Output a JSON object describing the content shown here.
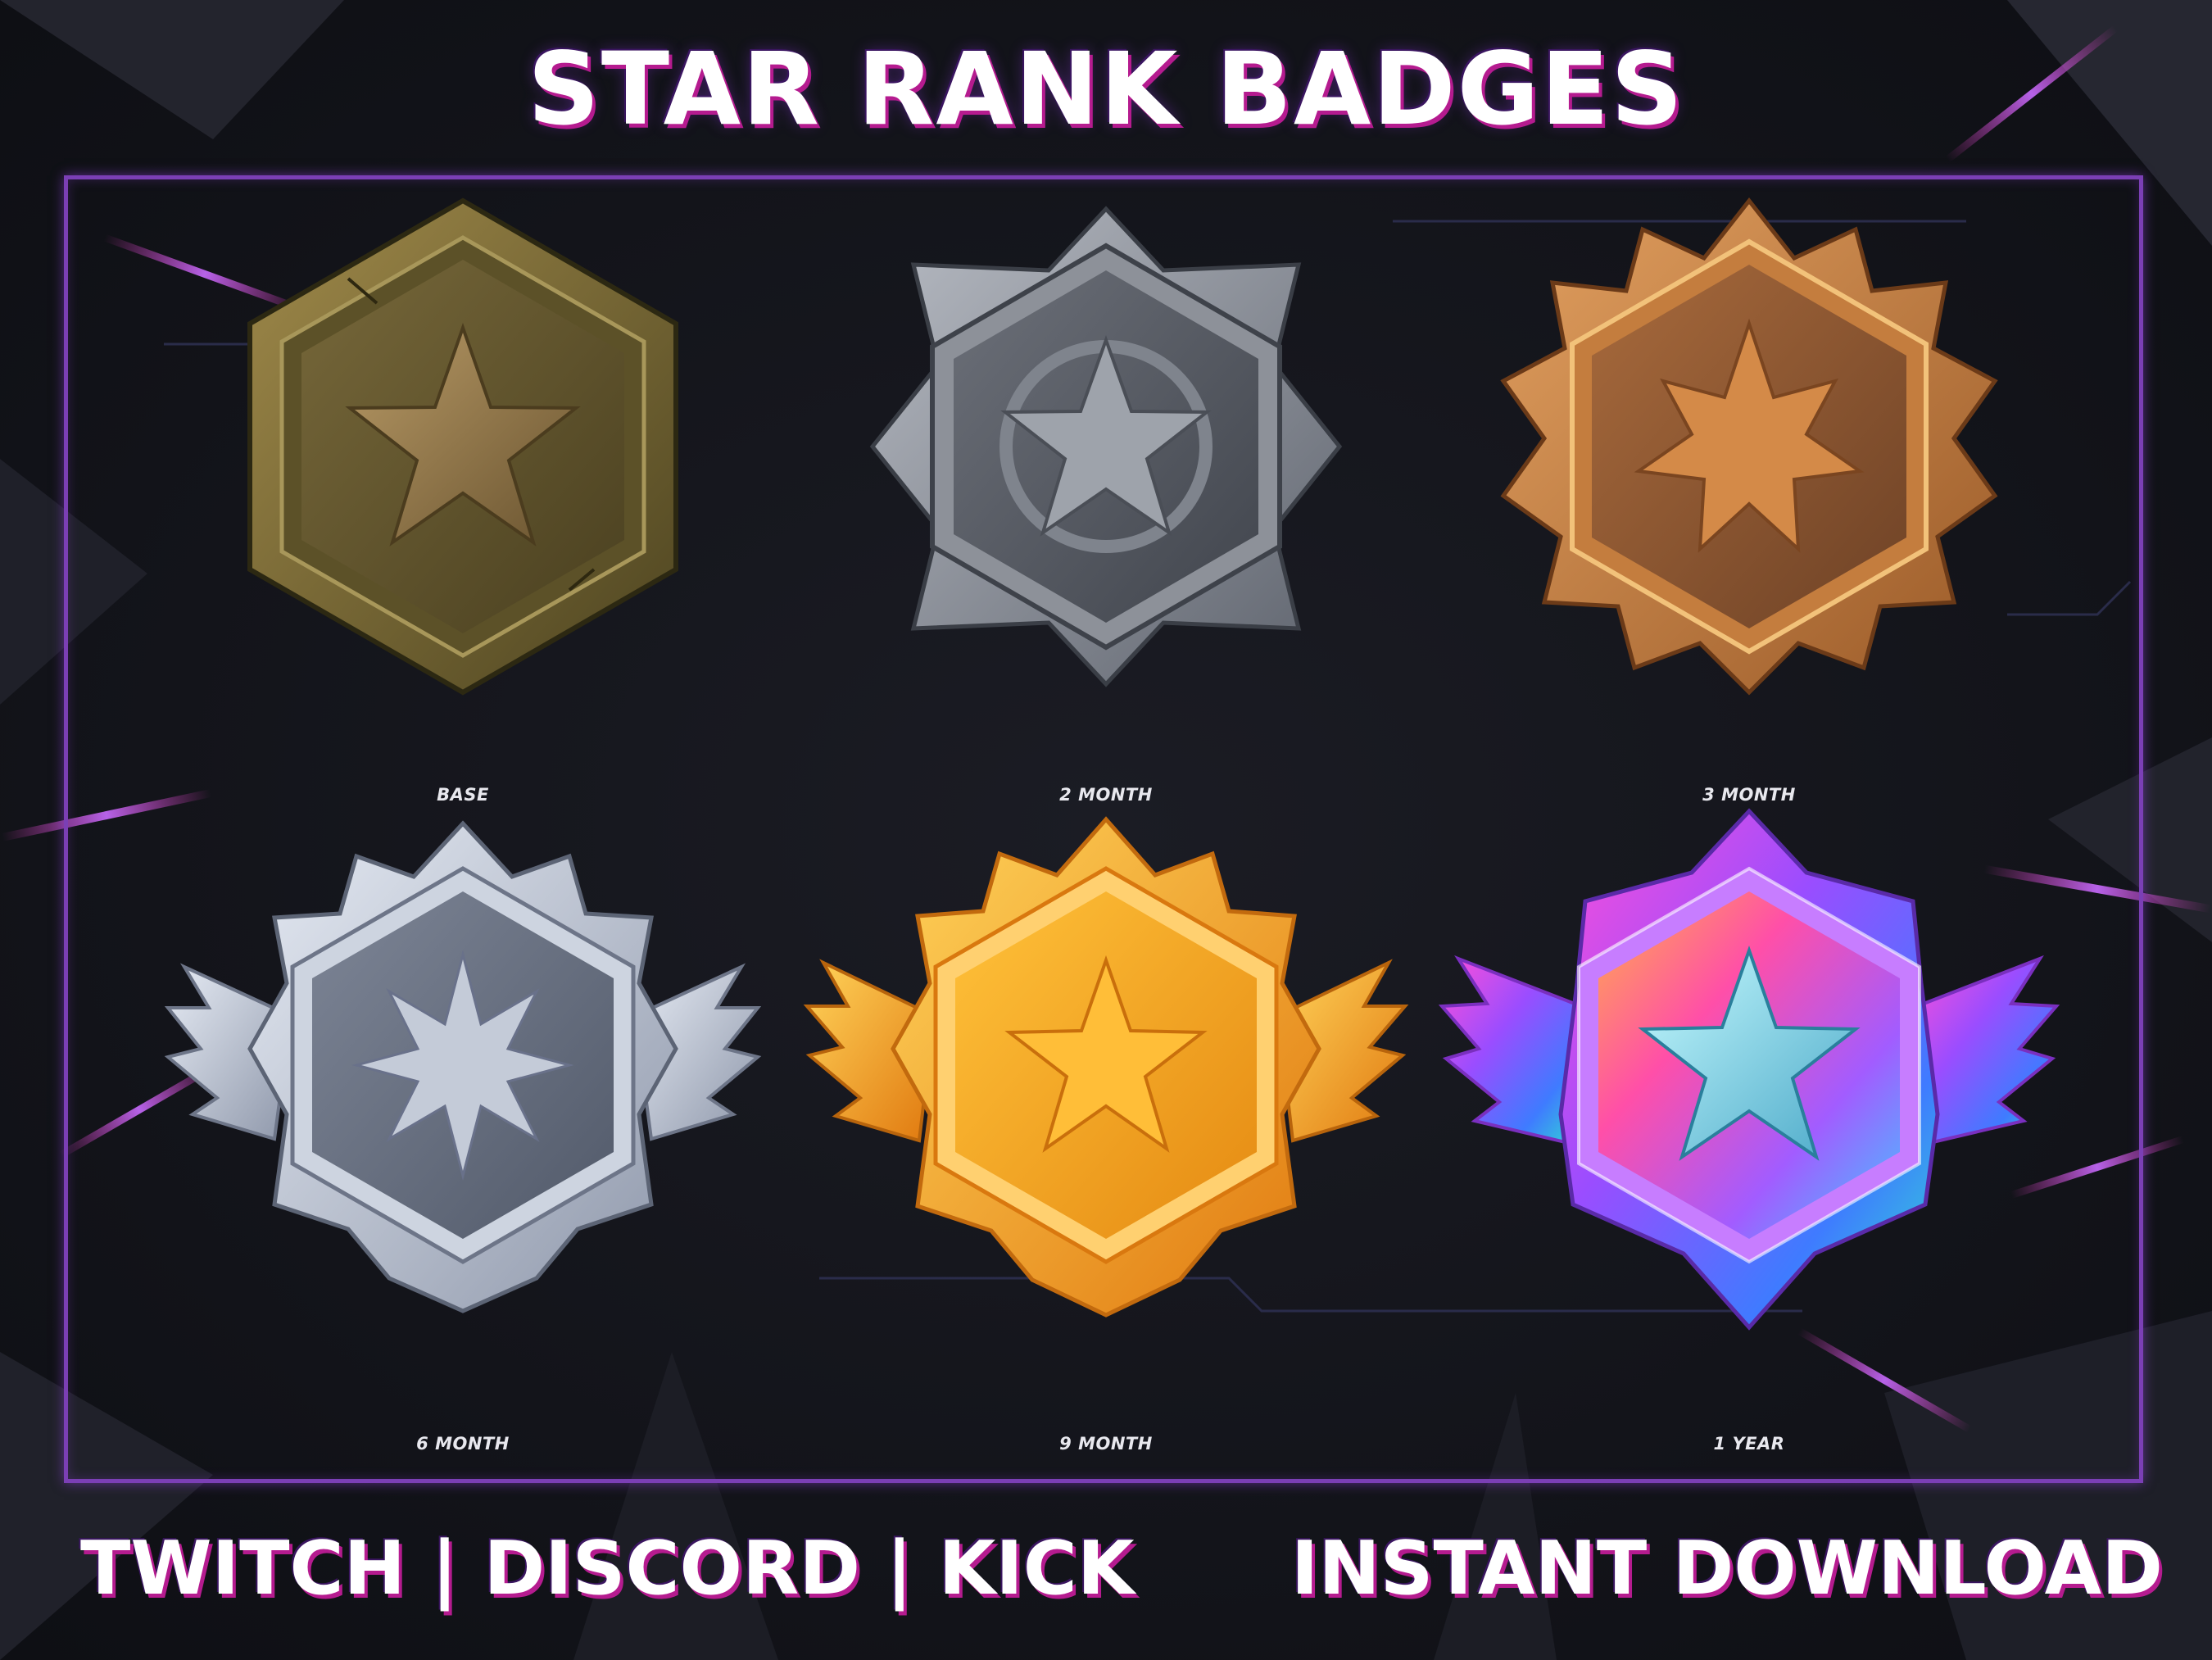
{
  "title": "STAR RANK BADGES",
  "badges": [
    {
      "label": "BASE",
      "tier": "bronze-olive"
    },
    {
      "label": "2 MONTH",
      "tier": "iron"
    },
    {
      "label": "3 MONTH",
      "tier": "copper"
    },
    {
      "label": "6 MONTH",
      "tier": "silver-winged"
    },
    {
      "label": "9 MONTH",
      "tier": "gold-winged"
    },
    {
      "label": "1 YEAR",
      "tier": "iridescent-winged"
    }
  ],
  "footer": {
    "platforms": "TWITCH | DISCORD | KICK",
    "cta": "INSTANT DOWNLOAD"
  },
  "colors": {
    "background": "#14151b",
    "frame": "#7b3fb5",
    "accent_shadow": "#b51b8f"
  }
}
